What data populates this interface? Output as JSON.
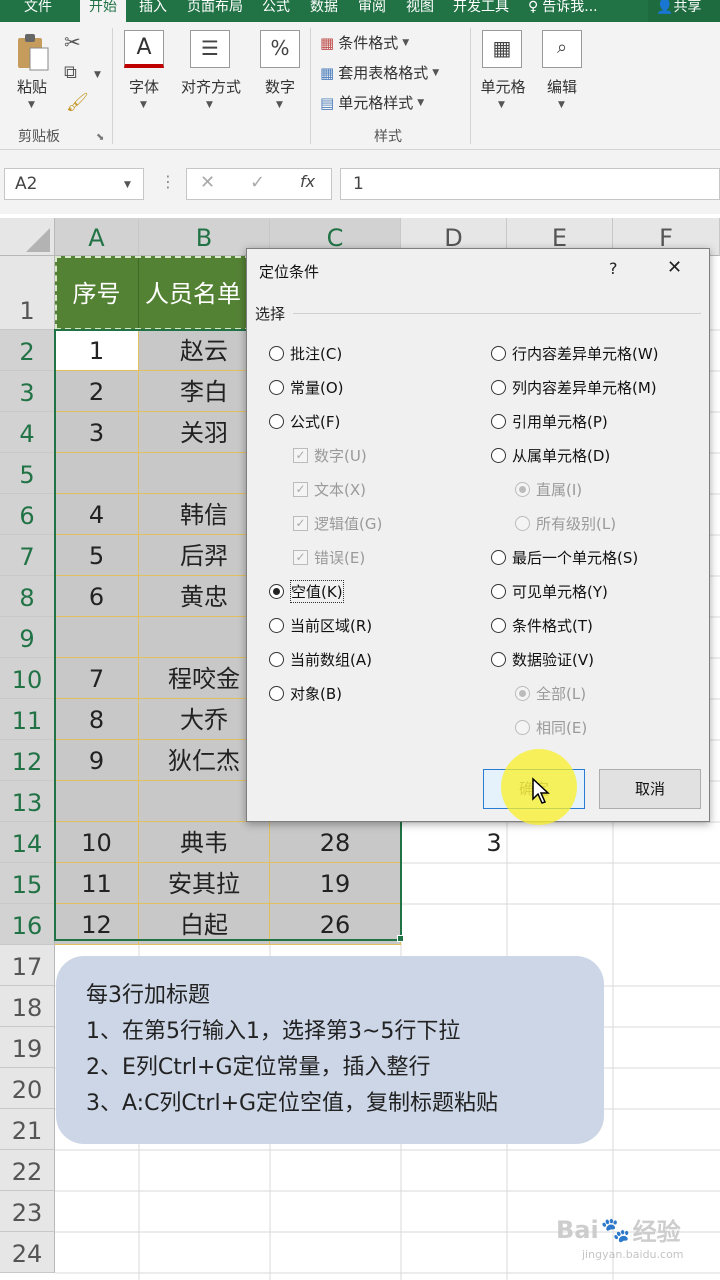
{
  "ribbon": {
    "tabs": [
      "文件",
      "开始",
      "插入",
      "页面布局",
      "公式",
      "数据",
      "审阅",
      "视图",
      "开发工具"
    ],
    "tell_me": "告诉我...",
    "share": "共享",
    "paste": "粘贴",
    "clipboard_group": "剪贴板",
    "font": "字体",
    "alignment": "对齐方式",
    "number": "数字",
    "conditional_format": "条件格式",
    "table_format": "套用表格格式",
    "cell_style": "单元格样式",
    "styles_group": "样式",
    "cells": "单元格",
    "editing": "编辑"
  },
  "formula_bar": {
    "name_box": "A2",
    "fx": "fx",
    "value": "1"
  },
  "columns": [
    "A",
    "B",
    "C",
    "D",
    "E",
    "F"
  ],
  "rows": [
    "1",
    "2",
    "3",
    "4",
    "5",
    "6",
    "7",
    "8",
    "9",
    "10",
    "11",
    "12",
    "13",
    "14",
    "15",
    "16",
    "17",
    "18",
    "19",
    "20",
    "21",
    "22",
    "23",
    "24"
  ],
  "table": {
    "header": [
      "序号",
      "人员名单"
    ],
    "body": [
      [
        "1",
        "赵云",
        ""
      ],
      [
        "2",
        "李白",
        ""
      ],
      [
        "3",
        "关羽",
        ""
      ],
      [
        "",
        "",
        ""
      ],
      [
        "4",
        "韩信",
        ""
      ],
      [
        "5",
        "后羿",
        ""
      ],
      [
        "6",
        "黄忠",
        ""
      ],
      [
        "",
        "",
        ""
      ],
      [
        "7",
        "程咬金",
        ""
      ],
      [
        "8",
        "大乔",
        ""
      ],
      [
        "9",
        "狄仁杰",
        ""
      ],
      [
        "",
        "",
        ""
      ],
      [
        "10",
        "典韦",
        "28"
      ],
      [
        "11",
        "安其拉",
        "19"
      ],
      [
        "12",
        "白起",
        "26"
      ]
    ]
  },
  "d14_value": "3",
  "dialog": {
    "title": "定位条件",
    "help": "?",
    "close": "✕",
    "group": "选择",
    "left_options": [
      "批注(C)",
      "常量(O)",
      "公式(F)",
      "数字(U)",
      "文本(X)",
      "逻辑值(G)",
      "错误(E)",
      "空值(K)",
      "当前区域(R)",
      "当前数组(A)",
      "对象(B)"
    ],
    "right_options": [
      "行内容差异单元格(W)",
      "列内容差异单元格(M)",
      "引用单元格(P)",
      "从属单元格(D)",
      "直属(I)",
      "所有级别(L)",
      "最后一个单元格(S)",
      "可见单元格(Y)",
      "条件格式(T)",
      "数据验证(V)",
      "全部(L)",
      "相同(E)"
    ],
    "selected": "空值(K)",
    "ok": "确定",
    "cancel": "取消"
  },
  "note": {
    "line1": "每3行加标题",
    "line2": "1、在第5行输入1，选择第3~5行下拉",
    "line3": "2、E列Ctrl+G定位常量，插入整行",
    "line4": "3、A:C列Ctrl+G定位空值，复制标题粘贴"
  },
  "watermark": {
    "brand": "Bai",
    "brand2": "经验",
    "url": "jingyan.baidu.com"
  },
  "colors": {
    "excel_green": "#217346",
    "header_fill": "#548235",
    "selection_gray": "#c8c8c8",
    "note_bg": "#ccd6e6"
  }
}
